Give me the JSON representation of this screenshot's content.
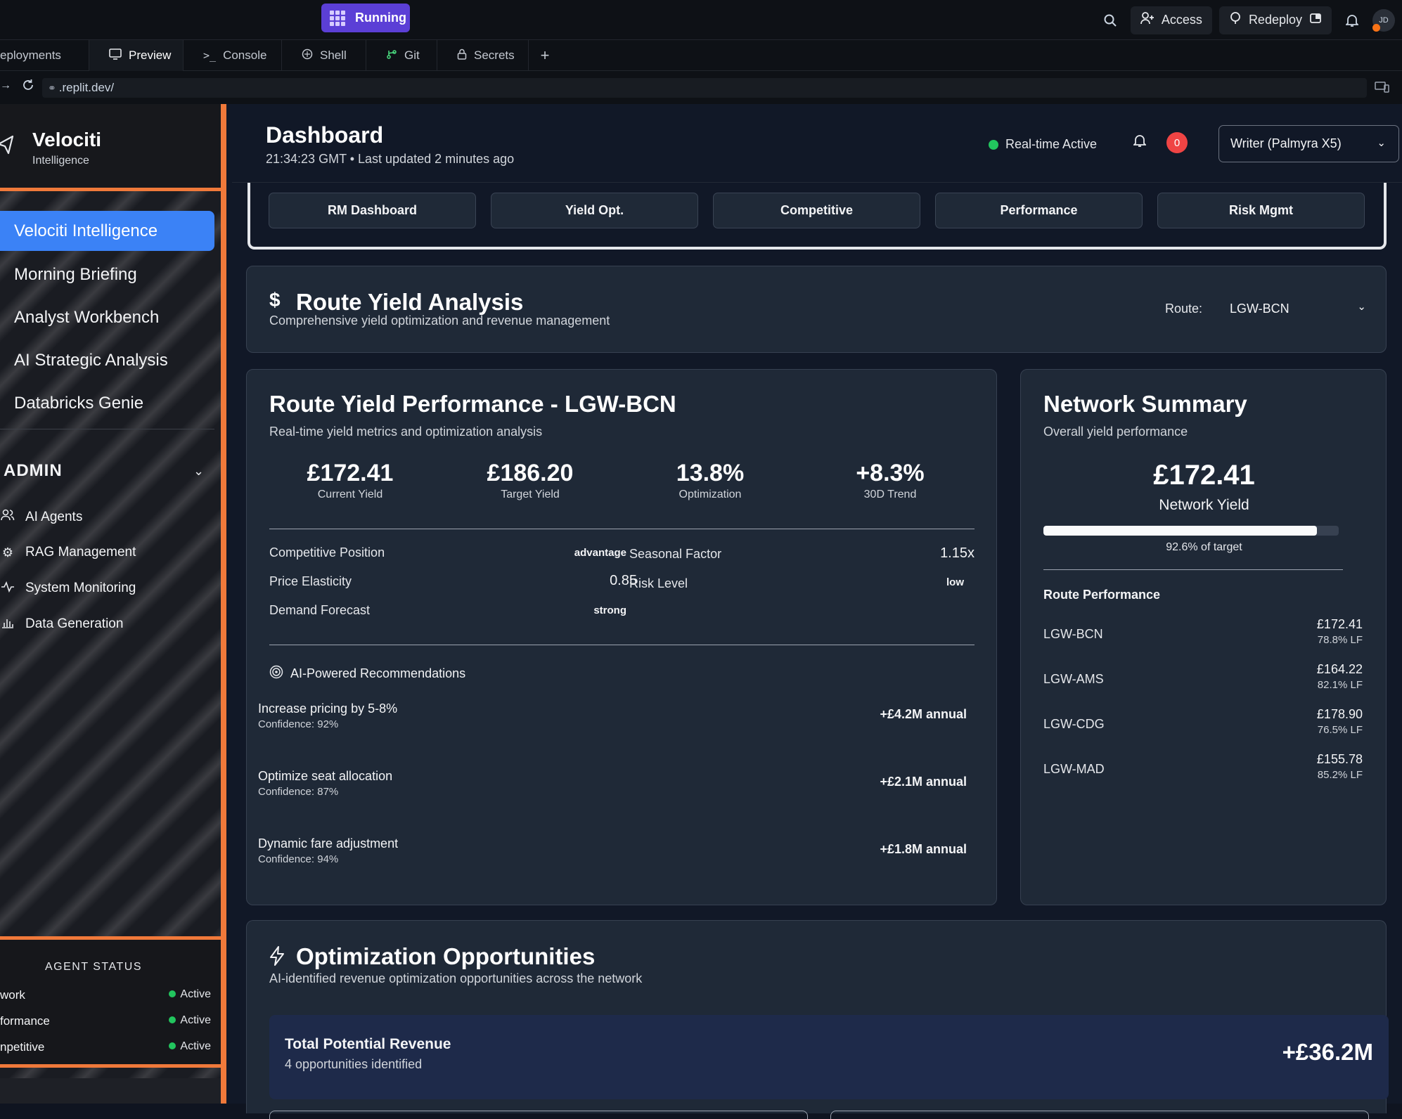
{
  "topbar": {
    "running_label": "Running",
    "access_label": "Access",
    "redeploy_label": "Redeploy",
    "avatar_initials": "JD"
  },
  "tabs": [
    {
      "label": "eployments",
      "icon": "none"
    },
    {
      "label": "Preview",
      "icon": "monitor-icon"
    },
    {
      "label": "Console",
      "icon": "terminal-icon"
    },
    {
      "label": "Shell",
      "icon": "shell-icon"
    },
    {
      "label": "Git",
      "icon": "git-icon"
    },
    {
      "label": "Secrets",
      "icon": "lock-icon"
    }
  ],
  "url": ".replit.dev/",
  "sidebar": {
    "brand": "Velociti",
    "brand_sub": "Intelligence",
    "nav": [
      {
        "label": "Velociti Intelligence"
      },
      {
        "label": "Morning Briefing"
      },
      {
        "label": "Analyst Workbench"
      },
      {
        "label": "AI Strategic Analysis"
      },
      {
        "label": "Databricks Genie"
      }
    ],
    "admin_label": "ADMIN",
    "admin_items": [
      {
        "label": "AI Agents"
      },
      {
        "label": "RAG Management"
      },
      {
        "label": "System Monitoring"
      },
      {
        "label": "Data Generation"
      }
    ],
    "agent_status": {
      "title": "AGENT STATUS",
      "rows": [
        {
          "name": "work",
          "status": "Active"
        },
        {
          "name": "formance",
          "status": "Active"
        },
        {
          "name": "npetitive",
          "status": "Active"
        }
      ]
    }
  },
  "header": {
    "title": "Dashboard",
    "subtitle": "21:34:23 GMT • Last updated 2 minutes ago",
    "realtime": "Real-time Active",
    "notif_count": "0",
    "model": "Writer (Palmyra X5)"
  },
  "quick_tabs": [
    "RM Dashboard",
    "Yield Opt.",
    "Competitive",
    "Performance",
    "Risk Mgmt"
  ],
  "route_analysis": {
    "icon": "$",
    "title": "Route Yield Analysis",
    "subtitle": "Comprehensive yield optimization and revenue management",
    "route_label": "Route:",
    "route_value": "LGW-BCN"
  },
  "performance": {
    "title": "Route Yield Performance - LGW-BCN",
    "subtitle": "Real-time yield metrics and optimization analysis",
    "metrics": [
      {
        "value": "£172.41",
        "label": "Current Yield"
      },
      {
        "value": "£186.20",
        "label": "Target Yield"
      },
      {
        "value": "13.8%",
        "label": "Optimization"
      },
      {
        "value": "+8.3%",
        "label": "30D Trend"
      }
    ],
    "factors_left": [
      {
        "key": "Competitive Position",
        "value": "advantage"
      },
      {
        "key": "Price Elasticity",
        "value": "0.85"
      },
      {
        "key": "Demand Forecast",
        "value": "strong"
      }
    ],
    "factors_right": [
      {
        "key": "Seasonal Factor",
        "value": "1.15x"
      },
      {
        "key": "Risk Level",
        "value": "low"
      }
    ],
    "rec_title": "AI-Powered Recommendations",
    "recommendations": [
      {
        "title": "Increase pricing by 5-8%",
        "confidence": "Confidence: 92%",
        "amount": "+£4.2M annual"
      },
      {
        "title": "Optimize seat allocation",
        "confidence": "Confidence: 87%",
        "amount": "+£2.1M annual"
      },
      {
        "title": "Dynamic fare adjustment",
        "confidence": "Confidence: 94%",
        "amount": "+£1.8M annual"
      }
    ]
  },
  "network": {
    "title": "Network Summary",
    "subtitle": "Overall yield performance",
    "yield_value": "£172.41",
    "yield_label": "Network Yield",
    "progress_fraction": 0.926,
    "progress_text": "92.6% of target",
    "routes_title": "Route Performance",
    "routes": [
      {
        "name": "LGW-BCN",
        "price": "£172.41",
        "lf": "78.8% LF"
      },
      {
        "name": "LGW-AMS",
        "price": "£164.22",
        "lf": "82.1% LF"
      },
      {
        "name": "LGW-CDG",
        "price": "£178.90",
        "lf": "76.5% LF"
      },
      {
        "name": "LGW-MAD",
        "price": "£155.78",
        "lf": "85.2% LF"
      }
    ]
  },
  "opportunities": {
    "title": "Optimization Opportunities",
    "subtitle": "AI-identified revenue optimization opportunities across the network",
    "total_label": "Total Potential Revenue",
    "total_sub": "4 opportunities identified",
    "total_value": "+£36.2M"
  }
}
